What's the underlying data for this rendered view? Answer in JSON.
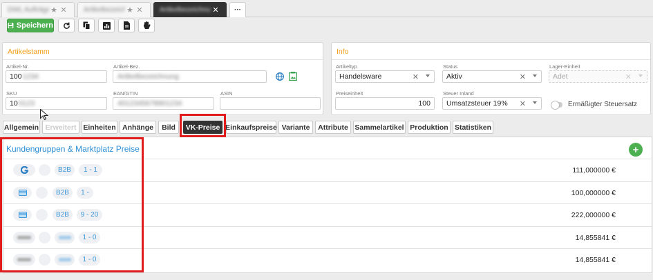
{
  "window_tabs": [
    {
      "label": "DWL Aufträge Ü...",
      "active": false
    },
    {
      "label": "Artikelbezeich",
      "active": false
    },
    {
      "label": "Artikelbezeichnung",
      "active": true
    }
  ],
  "window_tab_more": "···",
  "toolbar": {
    "save_label": "Speichern"
  },
  "artikelstamm": {
    "title": "Artikelstamm",
    "artikel_nr_label": "Artikel-Nr.",
    "artikel_nr_value": "100",
    "artikel_nr_blurred": "1234",
    "artikel_bez_label": "Artikel-Bez.",
    "artikel_bez_blurred": "Artikelbezeichnung",
    "sku_label": "SKU",
    "sku_value": "10",
    "sku_blurred": "0123",
    "ean_label": "EAN/GTIN",
    "ean_blurred": "4012345678901234",
    "asin_label": "ASIN",
    "asin_value": ""
  },
  "info": {
    "title": "Info",
    "artikeltyp_label": "Artikeltyp",
    "artikeltyp_value": "Handelsware",
    "status_label": "Status",
    "status_value": "Aktiv",
    "lager_label": "Lager-Einheit",
    "lager_value": "Adet",
    "preiseinheit_label": "Preiseinheit",
    "preiseinheit_value": "100",
    "steuer_label": "Steuer Inland",
    "steuer_value": "Umsatzsteuer 19%",
    "ermaessigt_label": "Ermäßigter Steuersatz"
  },
  "section_tabs": [
    {
      "label": "Allgemein"
    },
    {
      "label": "Erweitert"
    },
    {
      "label": "Einheiten"
    },
    {
      "label": "Anhänge"
    },
    {
      "label": "Bild"
    },
    {
      "label": "VK-Preise"
    },
    {
      "label": "Einkaufspreise"
    },
    {
      "label": "Variante"
    },
    {
      "label": "Attribute"
    },
    {
      "label": "Sammelartikel"
    },
    {
      "label": "Produktion"
    },
    {
      "label": "Statistiken"
    }
  ],
  "prices": {
    "title": "Kundengruppen & Marktplatz Preise",
    "rows": [
      {
        "icon": "g-logo-icon",
        "group": "B2B",
        "range": "1 - 1",
        "price": "111,000000 €"
      },
      {
        "icon": "card-icon",
        "group": "B2B",
        "range": "1 -",
        "price": "100,000000 €"
      },
      {
        "icon": "card-icon",
        "group": "B2B",
        "range": "9 - 20",
        "price": "222,000000 €"
      },
      {
        "icon": "blurred",
        "group": "",
        "range": "1 - 0",
        "price": "14,855841 €"
      },
      {
        "icon": "blurred",
        "group": "",
        "range": "1 - 0",
        "price": "14,855841 €"
      }
    ]
  },
  "colors": {
    "accent_green": "#4caf50",
    "title_orange": "#f39c12",
    "link_blue": "#2d8fd5",
    "highlight_red": "#e01c1c"
  }
}
